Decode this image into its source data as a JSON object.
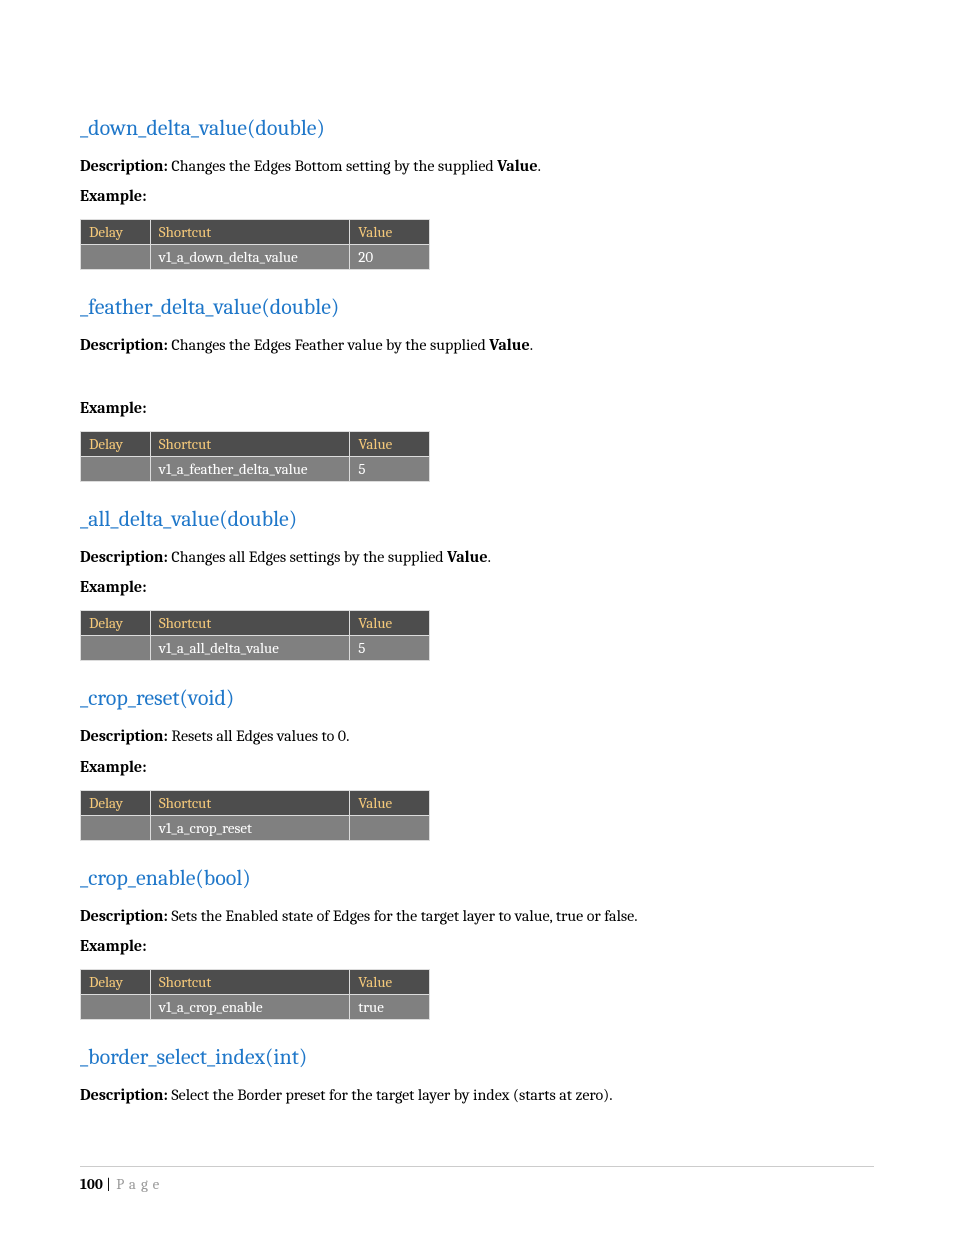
{
  "labels": {
    "description": "Description:",
    "example": "Example:"
  },
  "table_headers": {
    "delay": "Delay",
    "shortcut": "Shortcut",
    "value": "Value"
  },
  "sections": [
    {
      "title": "_down_delta_value(double)",
      "desc_pre": "Changes the Edges Bottom setting by the supplied ",
      "desc_bold": "Value",
      "desc_post": ".",
      "spacer": false,
      "row": {
        "delay": "",
        "shortcut": "v1_a_down_delta_value",
        "value": "20"
      }
    },
    {
      "title": "_feather_delta_value(double)",
      "desc_pre": "Changes the Edges Feather value by the supplied ",
      "desc_bold": "Value",
      "desc_post": ".",
      "spacer": true,
      "row": {
        "delay": "",
        "shortcut": "v1_a_feather_delta_value",
        "value": "5"
      }
    },
    {
      "title": "_all_delta_value(double)",
      "desc_pre": "Changes all Edges settings by the supplied ",
      "desc_bold": "Value",
      "desc_post": ".",
      "spacer": false,
      "row": {
        "delay": "",
        "shortcut": "v1_a_all_delta_value",
        "value": "5"
      }
    },
    {
      "title": "_crop_reset(void)",
      "desc_pre": "Resets all Edges values to 0.",
      "desc_bold": "",
      "desc_post": "",
      "spacer": false,
      "row": {
        "delay": "",
        "shortcut": "v1_a_crop_reset",
        "value": ""
      }
    },
    {
      "title": "_crop_enable(bool)",
      "desc_pre": "Sets the Enabled state of Edges for the target layer to value, true or false.",
      "desc_bold": "",
      "desc_post": "",
      "spacer": false,
      "row": {
        "delay": "",
        "shortcut": "v1_a_crop_enable",
        "value": "true"
      }
    },
    {
      "title": "_border_select_index(int)",
      "desc_pre": "Select the Border preset for the target layer by index (starts at zero).",
      "desc_bold": "",
      "desc_post": "",
      "spacer": false,
      "row": null
    }
  ],
  "footer": {
    "page_num": "100",
    "sep": " | ",
    "word": "Page"
  }
}
